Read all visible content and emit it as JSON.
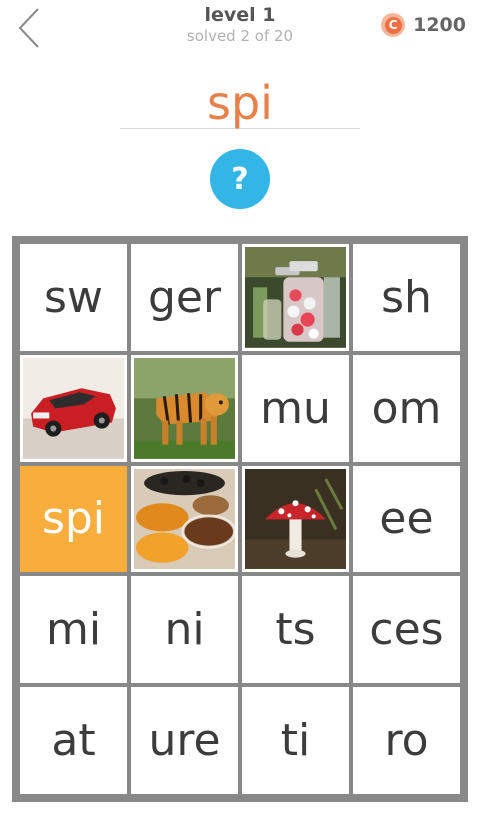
{
  "header": {
    "back_icon": "chevron-left-icon",
    "level_title": "level 1",
    "level_progress": "solved 2 of 20",
    "coin_symbol": "C",
    "coin_count": "1200"
  },
  "answer": {
    "text": "spi"
  },
  "hint": {
    "label": "?"
  },
  "board": {
    "rows": [
      [
        {
          "type": "text",
          "text": "sw"
        },
        {
          "type": "text",
          "text": "ger"
        },
        {
          "type": "image",
          "subject": "jars-of-sweets-photo"
        },
        {
          "type": "text",
          "text": "sh"
        }
      ],
      [
        {
          "type": "image",
          "subject": "red-car-photo"
        },
        {
          "type": "image",
          "subject": "tiger-photo"
        },
        {
          "type": "text",
          "text": "mu"
        },
        {
          "type": "text",
          "text": "om"
        }
      ],
      [
        {
          "type": "text",
          "text": "spi",
          "selected": true
        },
        {
          "type": "image",
          "subject": "spices-photo"
        },
        {
          "type": "image",
          "subject": "mushroom-photo"
        },
        {
          "type": "text",
          "text": "ee"
        }
      ],
      [
        {
          "type": "text",
          "text": "mi"
        },
        {
          "type": "text",
          "text": "ni"
        },
        {
          "type": "text",
          "text": "ts"
        },
        {
          "type": "text",
          "text": "ces"
        }
      ],
      [
        {
          "type": "text",
          "text": "at"
        },
        {
          "type": "text",
          "text": "ure"
        },
        {
          "type": "text",
          "text": "ti"
        },
        {
          "type": "text",
          "text": "ro"
        }
      ]
    ]
  },
  "colors": {
    "accent_orange": "#f9ad3c",
    "answer_orange": "#e8804a",
    "hint_blue": "#33b5e5",
    "grid_gray": "#888888",
    "coin_orange": "#ee6f43"
  }
}
